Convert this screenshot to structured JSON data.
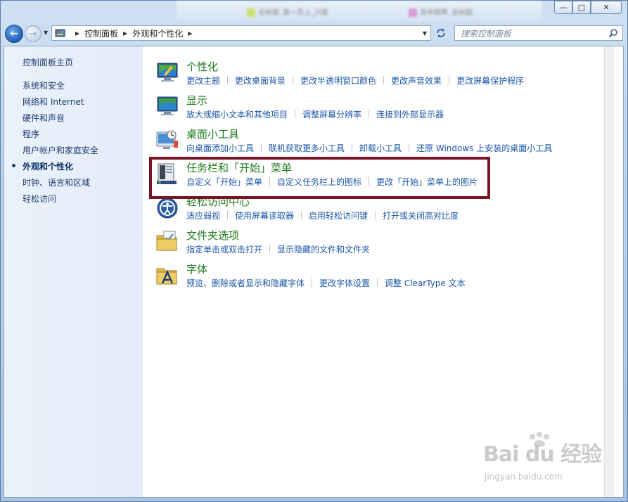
{
  "window": {
    "ghost_tabs": [
      "无标题_第一页上_只能",
      "发布频率_总标题"
    ],
    "caption": {
      "minimize": "—",
      "maximize": "□",
      "close": "✕"
    }
  },
  "nav": {
    "back_glyph": "←",
    "forward_glyph": "→",
    "breadcrumb": [
      "控制面板",
      "外观和个性化"
    ],
    "search_placeholder": "搜索控制面板"
  },
  "sidebar": {
    "home": "控制面板主页",
    "items": [
      {
        "label": "系统和安全",
        "active": false
      },
      {
        "label": "网络和 Internet",
        "active": false
      },
      {
        "label": "硬件和声音",
        "active": false
      },
      {
        "label": "程序",
        "active": false
      },
      {
        "label": "用户帐户和家庭安全",
        "active": false
      },
      {
        "label": "外观和个性化",
        "active": true
      },
      {
        "label": "时钟、语言和区域",
        "active": false
      },
      {
        "label": "轻松访问",
        "active": false
      }
    ]
  },
  "categories": [
    {
      "title": "个性化",
      "icon": "personalization-icon",
      "links": [
        "更改主题",
        "更改桌面背景",
        "更改半透明窗口颜色",
        "更改声音效果",
        "更改屏幕保护程序"
      ]
    },
    {
      "title": "显示",
      "icon": "display-icon",
      "links": [
        "放大或缩小文本和其他项目",
        "调整屏幕分辨率",
        "连接到外部显示器"
      ]
    },
    {
      "title": "桌面小工具",
      "icon": "gadgets-icon",
      "links": [
        "向桌面添加小工具",
        "联机获取更多小工具",
        "卸载小工具",
        "还原 Windows 上安装的桌面小工具"
      ]
    },
    {
      "title": "任务栏和「开始」菜单",
      "icon": "taskbar-icon",
      "links": [
        "自定义「开始」菜单",
        "自定义任务栏上的图标",
        "更改「开始」菜单上的图片"
      ]
    },
    {
      "title": "轻松访问中心",
      "icon": "ease-of-access-icon",
      "links": [
        "适应弱视",
        "使用屏幕读取器",
        "启用轻松访问键",
        "打开或关闭高对比度"
      ]
    },
    {
      "title": "文件夹选项",
      "icon": "folder-options-icon",
      "links": [
        "指定单击或双击打开",
        "显示隐藏的文件和文件夹"
      ]
    },
    {
      "title": "字体",
      "icon": "fonts-icon",
      "links": [
        "预览、删除或者显示和隐藏字体",
        "更改字体设置",
        "调整 ClearType 文本"
      ]
    }
  ],
  "watermark": {
    "main": "Bai du 经验",
    "sub": "jingyan.baidu.com"
  },
  "colors": {
    "title_green": "#1e7b1e",
    "link_blue": "#1a56a8",
    "highlight": "#7a1422"
  }
}
